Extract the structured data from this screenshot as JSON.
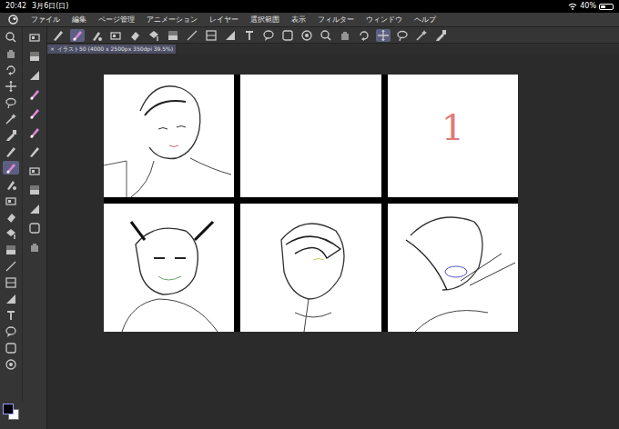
{
  "status_bar": {
    "time": "20:42",
    "date": "3月6日(日)",
    "battery": "40%",
    "battery_level": 0.4
  },
  "menu": [
    "ファイル",
    "編集",
    "ページ管理",
    "アニメーション",
    "レイヤー",
    "選択範囲",
    "表示",
    "フィルター",
    "ウィンドウ",
    "ヘルプ"
  ],
  "command_bar": [
    {
      "selected": false
    },
    {
      "selected": true
    },
    {
      "selected": false
    },
    {
      "selected": false
    },
    {
      "selected": false
    },
    {
      "selected": false
    },
    {
      "selected": false
    },
    {
      "selected": false
    },
    {
      "selected": false
    },
    {
      "selected": false
    },
    {
      "selected": false
    },
    {
      "selected": false
    },
    {
      "selected": false
    },
    {
      "selected": false
    },
    {
      "selected": false
    },
    {
      "selected": false
    },
    {
      "selected": false
    },
    {
      "selected": true
    },
    {
      "selected": false
    },
    {
      "selected": false
    },
    {
      "selected": false
    }
  ],
  "document_tab": {
    "close": "×",
    "label": "イラスト50 (4000 x 2500px 350dpi 39.5%)",
    "selected": true
  },
  "tools": [
    {
      "selected": false
    },
    {
      "selected": false
    },
    {
      "selected": false
    },
    {
      "selected": false
    },
    {
      "selected": false
    },
    {
      "selected": false
    },
    {
      "selected": false
    },
    {
      "selected": false
    },
    {
      "selected": true
    },
    {
      "selected": false
    },
    {
      "selected": false
    },
    {
      "selected": false
    },
    {
      "selected": false
    },
    {
      "selected": false
    },
    {
      "selected": false
    },
    {
      "selected": false
    },
    {
      "selected": false
    },
    {
      "selected": false
    },
    {
      "selected": false
    },
    {
      "selected": false
    },
    {
      "selected": false
    }
  ],
  "sub_tools": [
    {
      "selected": false
    },
    {
      "selected": false
    },
    {
      "selected": false
    },
    {
      "selected": false
    },
    {
      "selected": false
    },
    {
      "selected": false
    },
    {
      "selected": false
    },
    {
      "selected": false
    },
    {
      "selected": false
    },
    {
      "selected": false
    },
    {
      "selected": false
    },
    {
      "selected": false
    }
  ],
  "color_swatches": [
    {
      "color": "#000000",
      "selected": true
    },
    {
      "color": "#ffffff",
      "selected": false
    }
  ],
  "canvas": {
    "panels": [
      {
        "kind": "sketch"
      },
      {
        "kind": "blank"
      },
      {
        "kind": "number",
        "text": "1"
      },
      {
        "kind": "sketch"
      },
      {
        "kind": "sketch"
      },
      {
        "kind": "sketch"
      }
    ]
  }
}
